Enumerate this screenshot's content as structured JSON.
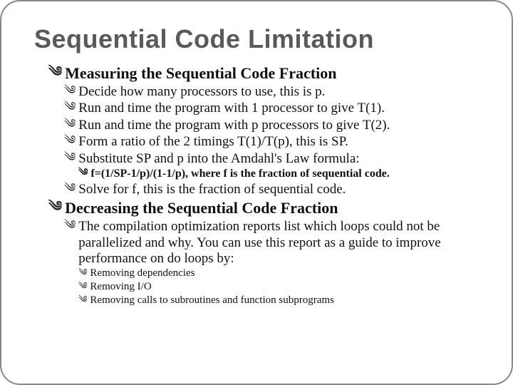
{
  "title": "Sequential Code Limitation",
  "sec1": {
    "head": "Measuring the Sequential Code Fraction",
    "i1": "Decide how many processors to use, this is p.",
    "i2": "Run and time the program with 1 processor to give T(1).",
    "i3": "Run and time the program with p processors to give T(2).",
    "i4": "Form a ratio of the 2 timings T(1)/T(p), this is SP.",
    "i5": "Substitute SP and p into the Amdahl's Law formula:",
    "i5a": "f=(1/SP-1/p)/(1-1/p), where f is the fraction of sequential code.",
    "i6": "Solve for f, this is the fraction of sequential code."
  },
  "sec2": {
    "head": "Decreasing the Sequential Code Fraction",
    "i1": "The compilation optimization reports list which loops could not be parallelized and why. You can use this report as a guide to improve performance on do loops by:",
    "i1a": "Removing dependencies",
    "i1b": "Removing I/O",
    "i1c": "Removing calls to subroutines and function subprograms"
  },
  "glyph": "༄"
}
